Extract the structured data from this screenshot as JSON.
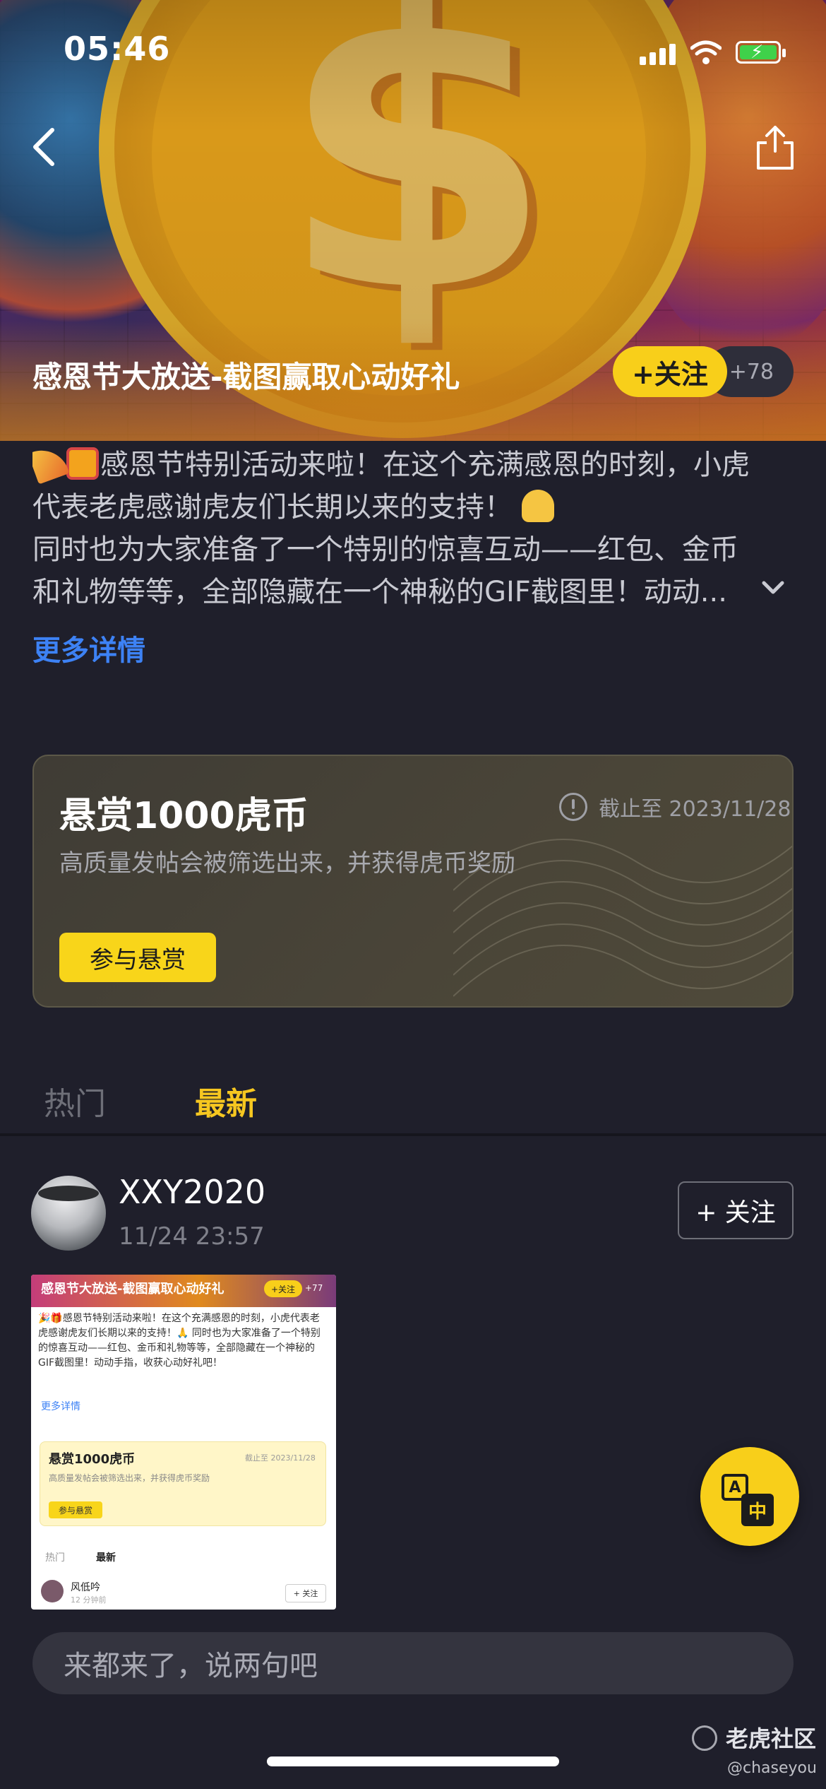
{
  "status": {
    "time": "05:46"
  },
  "topic": {
    "title": "感恩节大放送-截图赢取心动好礼",
    "follow_label": "+关注",
    "follower_count": "+78"
  },
  "description": {
    "line1": "感恩节特别活动来啦！在这个充满感恩的时刻，小虎",
    "line2": "代表老虎感谢虎友们长期以来的支持！",
    "line3": "同时也为大家准备了一个特别的惊喜互动——红包、金币",
    "line4": "和礼物等等，全部隐藏在一个神秘的GIF截图里！动动...",
    "more_label": "更多详情"
  },
  "reward": {
    "title": "悬赏1000虎币",
    "deadline": "截止至 2023/11/28",
    "subtitle": "高质量发帖会被筛选出来，并获得虎币奖励",
    "button_label": "参与悬赏"
  },
  "tabs": {
    "hot": "热门",
    "latest": "最新"
  },
  "post": {
    "username": "XXY2020",
    "time": "11/24 23:57",
    "follow_label": "+ 关注",
    "thumb": {
      "title": "感恩节大放送-截图赢取心动好礼",
      "follow_label": "+关注",
      "count": "+77",
      "desc": "🎉🎁感恩节特别活动来啦！在这个充满感恩的时刻，小虎代表老虎感谢虎友们长期以来的支持！🙏 同时也为大家准备了一个特别的惊喜互动——红包、金币和礼物等等，全部隐藏在一个神秘的GIF截图里！动动手指，收获心动好礼吧！",
      "more_label": "更多详情",
      "card_title": "悬赏1000虎币",
      "card_deadline": "截止至 2023/11/28",
      "card_sub": "高质量发帖会被筛选出来，并获得虎币奖励",
      "card_button": "参与悬赏",
      "tab_hot": "热门",
      "tab_latest": "最新",
      "user": "风低吟",
      "user_time": "12 分钟前",
      "user_follow": "+ 关注"
    }
  },
  "translate": {
    "a": "A",
    "zh": "中"
  },
  "comment": {
    "placeholder": "来都来了，说两句吧"
  },
  "watermark": {
    "brand": "老虎社区",
    "user": "@chaseyou"
  },
  "colors": {
    "accent": "#f8cf1a",
    "link": "#3d82f5",
    "background": "#1f1f2b"
  }
}
